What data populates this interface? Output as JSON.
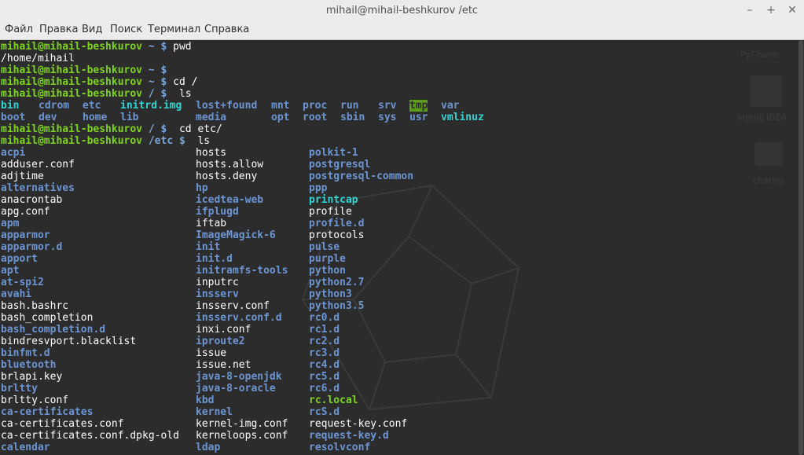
{
  "window": {
    "title": "mihail@mihail-beshkurov /etc",
    "controls": {
      "minimize": "–",
      "maximize": "+",
      "close": "✕"
    }
  },
  "menu": [
    "Файл",
    "Правка",
    "Вид",
    "Поиск",
    "Терминал",
    "Справка"
  ],
  "wallpaper_labels": [
    "PyCharm",
    "IntelliJ IDEA",
    "charles"
  ],
  "terminal": {
    "prompt_user": "mihail@mihail-beshkurov",
    "lines": [
      {
        "path": "~",
        "cmd": "pwd"
      },
      {
        "output": "/home/mihail"
      },
      {
        "path": "~",
        "cmd": ""
      },
      {
        "path": "~",
        "cmd": "cd /"
      },
      {
        "path": "/",
        "cmd": " ls"
      }
    ],
    "root_ls": [
      [
        {
          "t": "bin",
          "k": "link"
        },
        {
          "t": "cdrom",
          "k": "dir"
        },
        {
          "t": "etc",
          "k": "dir"
        },
        {
          "t": "initrd.img",
          "k": "link"
        },
        {
          "t": "lost+found",
          "k": "dir"
        },
        {
          "t": "mnt",
          "k": "dir"
        },
        {
          "t": "proc",
          "k": "dir"
        },
        {
          "t": "run",
          "k": "dir"
        },
        {
          "t": "srv",
          "k": "dir"
        },
        {
          "t": "tmp",
          "k": "tmp"
        },
        {
          "t": "var",
          "k": "dir"
        }
      ],
      [
        {
          "t": "boot",
          "k": "dir"
        },
        {
          "t": "dev",
          "k": "dir"
        },
        {
          "t": "home",
          "k": "dir"
        },
        {
          "t": "lib",
          "k": "dir"
        },
        {
          "t": "media",
          "k": "dir"
        },
        {
          "t": "opt",
          "k": "dir"
        },
        {
          "t": "root",
          "k": "dir"
        },
        {
          "t": "sbin",
          "k": "dir"
        },
        {
          "t": "sys",
          "k": "dir"
        },
        {
          "t": "usr",
          "k": "dir"
        },
        {
          "t": "vmlinuz",
          "k": "link"
        }
      ]
    ],
    "lines2": [
      {
        "path": "/",
        "cmd": " cd etc/"
      },
      {
        "path": "/etc",
        "cmd": " ls"
      }
    ],
    "etc_ls": [
      [
        {
          "t": "acpi",
          "k": "dir"
        },
        {
          "t": "hosts",
          "k": "file"
        },
        {
          "t": "polkit-1",
          "k": "dir"
        }
      ],
      [
        {
          "t": "adduser.conf",
          "k": "file"
        },
        {
          "t": "hosts.allow",
          "k": "file"
        },
        {
          "t": "postgresql",
          "k": "dir"
        }
      ],
      [
        {
          "t": "adjtime",
          "k": "file"
        },
        {
          "t": "hosts.deny",
          "k": "file"
        },
        {
          "t": "postgresql-common",
          "k": "dir"
        }
      ],
      [
        {
          "t": "alternatives",
          "k": "dir"
        },
        {
          "t": "hp",
          "k": "dir"
        },
        {
          "t": "ppp",
          "k": "dir"
        }
      ],
      [
        {
          "t": "anacrontab",
          "k": "file"
        },
        {
          "t": "icedtea-web",
          "k": "dir"
        },
        {
          "t": "printcap",
          "k": "link"
        }
      ],
      [
        {
          "t": "apg.conf",
          "k": "file"
        },
        {
          "t": "ifplugd",
          "k": "dir"
        },
        {
          "t": "profile",
          "k": "file"
        }
      ],
      [
        {
          "t": "apm",
          "k": "dir"
        },
        {
          "t": "iftab",
          "k": "file"
        },
        {
          "t": "profile.d",
          "k": "dir"
        }
      ],
      [
        {
          "t": "apparmor",
          "k": "dir"
        },
        {
          "t": "ImageMagick-6",
          "k": "dir"
        },
        {
          "t": "protocols",
          "k": "file"
        }
      ],
      [
        {
          "t": "apparmor.d",
          "k": "dir"
        },
        {
          "t": "init",
          "k": "dir"
        },
        {
          "t": "pulse",
          "k": "dir"
        }
      ],
      [
        {
          "t": "apport",
          "k": "dir"
        },
        {
          "t": "init.d",
          "k": "dir"
        },
        {
          "t": "purple",
          "k": "dir"
        }
      ],
      [
        {
          "t": "apt",
          "k": "dir"
        },
        {
          "t": "initramfs-tools",
          "k": "dir"
        },
        {
          "t": "python",
          "k": "dir"
        }
      ],
      [
        {
          "t": "at-spi2",
          "k": "dir"
        },
        {
          "t": "inputrc",
          "k": "file"
        },
        {
          "t": "python2.7",
          "k": "dir"
        }
      ],
      [
        {
          "t": "avahi",
          "k": "dir"
        },
        {
          "t": "insserv",
          "k": "dir"
        },
        {
          "t": "python3",
          "k": "dir"
        }
      ],
      [
        {
          "t": "bash.bashrc",
          "k": "file"
        },
        {
          "t": "insserv.conf",
          "k": "file"
        },
        {
          "t": "python3.5",
          "k": "dir"
        }
      ],
      [
        {
          "t": "bash_completion",
          "k": "file"
        },
        {
          "t": "insserv.conf.d",
          "k": "dir"
        },
        {
          "t": "rc0.d",
          "k": "dir"
        }
      ],
      [
        {
          "t": "bash_completion.d",
          "k": "dir"
        },
        {
          "t": "inxi.conf",
          "k": "file"
        },
        {
          "t": "rc1.d",
          "k": "dir"
        }
      ],
      [
        {
          "t": "bindresvport.blacklist",
          "k": "file"
        },
        {
          "t": "iproute2",
          "k": "dir"
        },
        {
          "t": "rc2.d",
          "k": "dir"
        }
      ],
      [
        {
          "t": "binfmt.d",
          "k": "dir"
        },
        {
          "t": "issue",
          "k": "file"
        },
        {
          "t": "rc3.d",
          "k": "dir"
        }
      ],
      [
        {
          "t": "bluetooth",
          "k": "dir"
        },
        {
          "t": "issue.net",
          "k": "file"
        },
        {
          "t": "rc4.d",
          "k": "dir"
        }
      ],
      [
        {
          "t": "brlapi.key",
          "k": "file"
        },
        {
          "t": "java-8-openjdk",
          "k": "dir"
        },
        {
          "t": "rc5.d",
          "k": "dir"
        }
      ],
      [
        {
          "t": "brltty",
          "k": "dir"
        },
        {
          "t": "java-8-oracle",
          "k": "dir"
        },
        {
          "t": "rc6.d",
          "k": "dir"
        }
      ],
      [
        {
          "t": "brltty.conf",
          "k": "file"
        },
        {
          "t": "kbd",
          "k": "dir"
        },
        {
          "t": "rc.local",
          "k": "exec"
        }
      ],
      [
        {
          "t": "ca-certificates",
          "k": "dir"
        },
        {
          "t": "kernel",
          "k": "dir"
        },
        {
          "t": "rcS.d",
          "k": "dir"
        }
      ],
      [
        {
          "t": "ca-certificates.conf",
          "k": "file"
        },
        {
          "t": "kernel-img.conf",
          "k": "file"
        },
        {
          "t": "request-key.conf",
          "k": "file"
        }
      ],
      [
        {
          "t": "ca-certificates.conf.dpkg-old",
          "k": "file"
        },
        {
          "t": "kerneloops.conf",
          "k": "file"
        },
        {
          "t": "request-key.d",
          "k": "dir"
        }
      ],
      [
        {
          "t": "calendar",
          "k": "dir"
        },
        {
          "t": "ldap",
          "k": "dir"
        },
        {
          "t": "resolvconf",
          "k": "dir"
        }
      ]
    ]
  }
}
